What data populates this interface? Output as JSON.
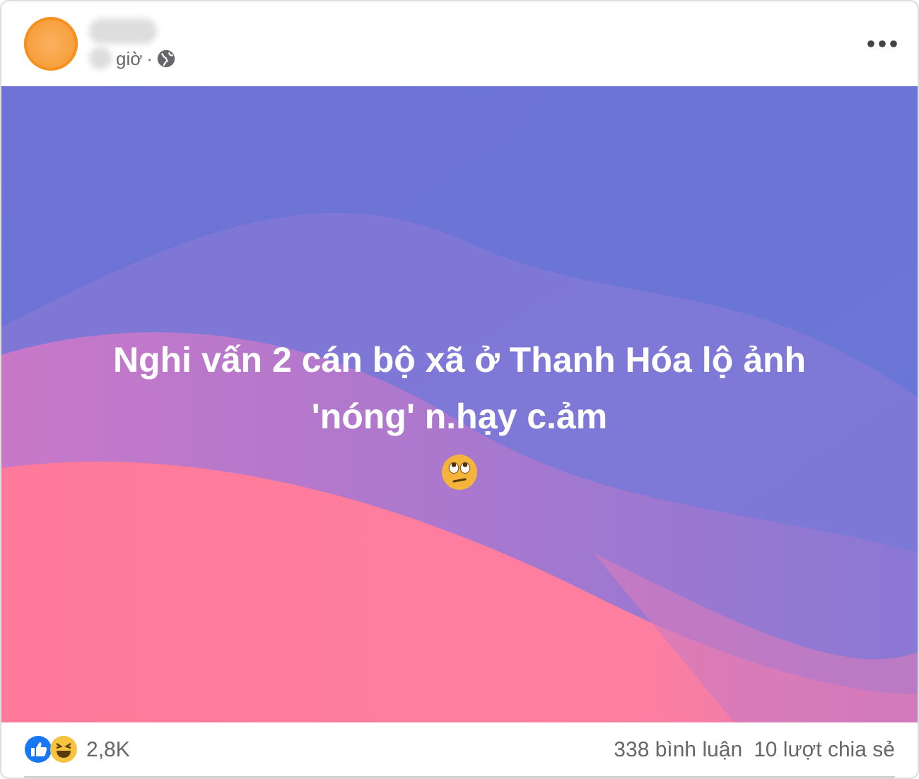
{
  "post": {
    "time": "giờ",
    "separator": "·",
    "text_lines": [
      "Nghi vấn 2 cán bộ xã ở Thanh Hóa lộ ảnh",
      "'nóng' n.hạy c.ảm"
    ]
  },
  "footer": {
    "reaction_count": "2,8K",
    "comments": "338 bình luận",
    "shares": "10 lượt chia sẻ"
  }
}
